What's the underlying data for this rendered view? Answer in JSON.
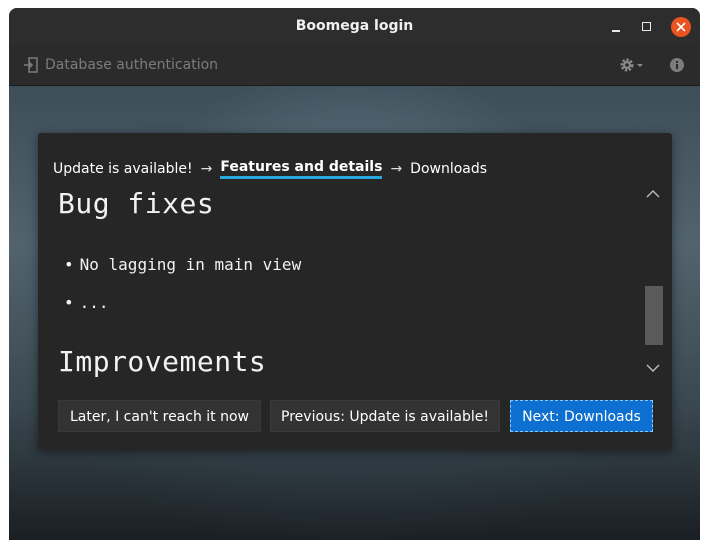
{
  "window": {
    "title": "Boomega login",
    "controls": {
      "minimize": "minimize-icon",
      "maximize": "maximize-icon",
      "close": "close-icon"
    },
    "close_color": "#e95420"
  },
  "toolbar": {
    "title": "Database authentication",
    "login_icon": "login-icon",
    "settings_icon": "gear-icon",
    "info_icon": "info-icon"
  },
  "wizard": {
    "steps": [
      "Update is available!",
      "Features and details",
      "Downloads"
    ],
    "current_step": "Features and details",
    "arrow": "→",
    "accent_color": "#29a8e0"
  },
  "content": {
    "heading_bug": "Bug fixes",
    "bug_items": [
      "No lagging in main view",
      "..."
    ],
    "heading_improvements": "Improvements",
    "bullet": "•"
  },
  "buttons": {
    "later": "Later, I can't reach it now",
    "previous": "Previous: Update is available!",
    "next": "Next: Downloads",
    "next_color": "#0d6fd0"
  }
}
